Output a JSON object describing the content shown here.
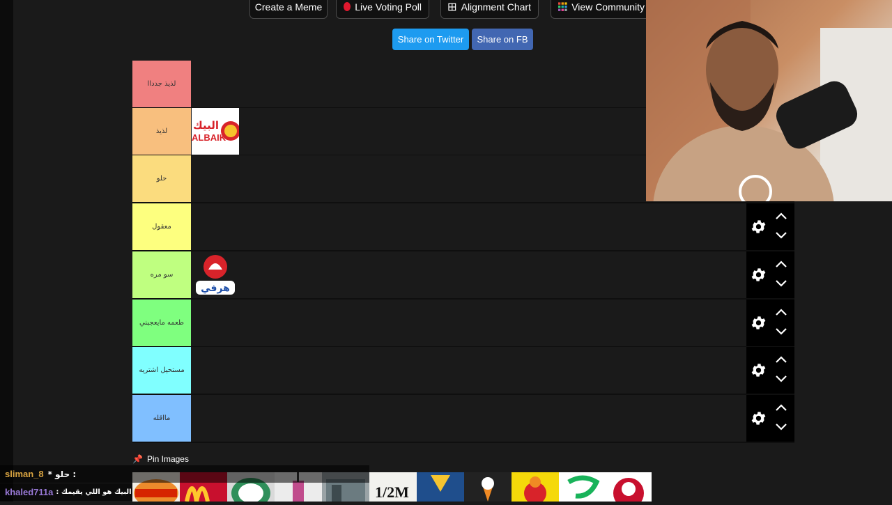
{
  "toolbar": {
    "create_meme": "Create a Meme",
    "live_poll": "Live Voting Poll",
    "alignment_chart": "Alignment Chart",
    "view_community": "View Community"
  },
  "share": {
    "twitter": "Share on Twitter",
    "fb": "Share on FB"
  },
  "tiers": [
    {
      "label": "لذيذ جدداا",
      "color": "#f08080"
    },
    {
      "label": "لذيذ",
      "color": "#f8bf7e"
    },
    {
      "label": "حلو",
      "color": "#fbdc7e"
    },
    {
      "label": "معقول",
      "color": "#fdff7f"
    },
    {
      "label": "سو مره",
      "color": "#bfff80"
    },
    {
      "label": "طعمه مايعجبني",
      "color": "#7fff7f"
    },
    {
      "label": "مستحيل اشتريه",
      "color": "#80ffff"
    },
    {
      "label": "مااقله",
      "color": "#80bfff"
    }
  ],
  "tier_items": {
    "tier_2": {
      "name": "البيك",
      "sub": "ALBAIK"
    },
    "tier_5": {
      "name": "هرفي"
    }
  },
  "pin_images": {
    "label": "Pin Images"
  },
  "chat": [
    {
      "user": "sliman_8",
      "message": "* حلو :",
      "user_color": "#d9a441"
    },
    {
      "user": "khaled711a",
      "message": ": البيك هو اللي يقيمك",
      "user_color": "#9a7ad8"
    }
  ],
  "tray": {
    "half_m": "1/2M"
  },
  "colors": {
    "twitter": "#1d9bf0",
    "facebook": "#4267b2",
    "control_bg": "#000000"
  }
}
